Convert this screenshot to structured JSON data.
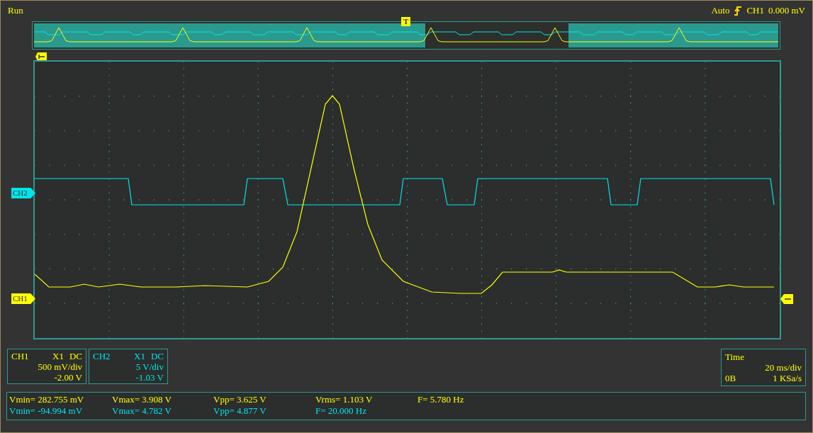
{
  "status": "Run",
  "trigger": {
    "mode": "Auto",
    "source": "CH1",
    "level": "0.000 mV",
    "marker": "T"
  },
  "channels": [
    {
      "name": "CH1",
      "probe": "X1",
      "coupling": "DC",
      "scale": "500 mV/div",
      "offset": "-2.00 V",
      "color": "#ffff00"
    },
    {
      "name": "CH2",
      "probe": "X1",
      "coupling": "DC",
      "scale": "5 V/div",
      "offset": "-1.03 V",
      "color": "#00e5ee"
    }
  ],
  "markers": [
    {
      "label": "CH2",
      "color": "#00e5ee"
    },
    {
      "label": "CH1",
      "color": "#ffff00"
    }
  ],
  "time": {
    "label": "Time",
    "scale": "20 ms/div",
    "memory": "0B",
    "rate": "1 KSa/s"
  },
  "measurements": [
    {
      "color": "#ffff00",
      "items": [
        "Vmin= 282.755 mV",
        "Vmax= 3.908 V",
        "Vpp= 3.625 V",
        "Vrms= 1.103 V",
        "F= 5.780 Hz"
      ]
    },
    {
      "color": "#00e5ee",
      "items": [
        "Vmin= -94.994 mV",
        "Vmax= 4.782 V",
        "Vpp= 4.877 V",
        "F= 20.000 Hz"
      ]
    }
  ]
}
